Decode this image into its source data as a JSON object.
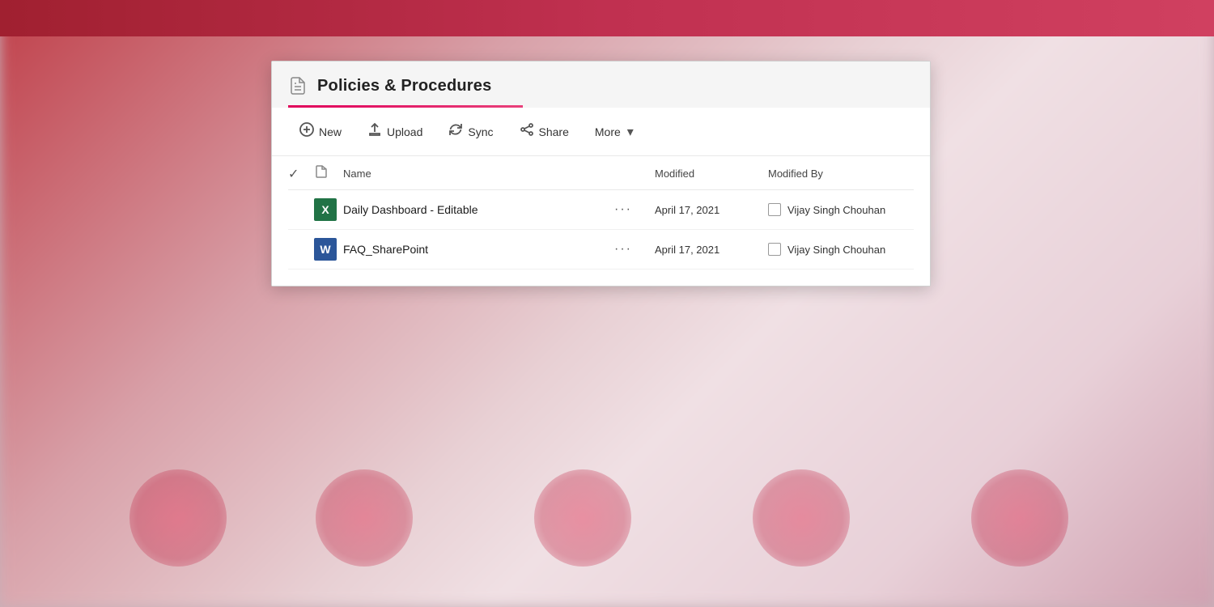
{
  "background": {
    "topBarColor": "#a02030"
  },
  "panel": {
    "title": "Policies & Procedures",
    "underlineColor": "#e0005a",
    "toolbar": {
      "new_label": "New",
      "upload_label": "Upload",
      "sync_label": "Sync",
      "share_label": "Share",
      "more_label": "More"
    },
    "table": {
      "headers": {
        "name": "Name",
        "modified": "Modified",
        "modified_by": "Modified By"
      },
      "rows": [
        {
          "name": "Daily Dashboard - Editable",
          "icon_type": "excel",
          "modified": "April 17, 2021",
          "modified_by": "Vijay Singh Chouhan"
        },
        {
          "name": "FAQ_SharePoint",
          "icon_type": "word",
          "modified": "April 17, 2021",
          "modified_by": "Vijay Singh Chouhan"
        }
      ]
    }
  }
}
